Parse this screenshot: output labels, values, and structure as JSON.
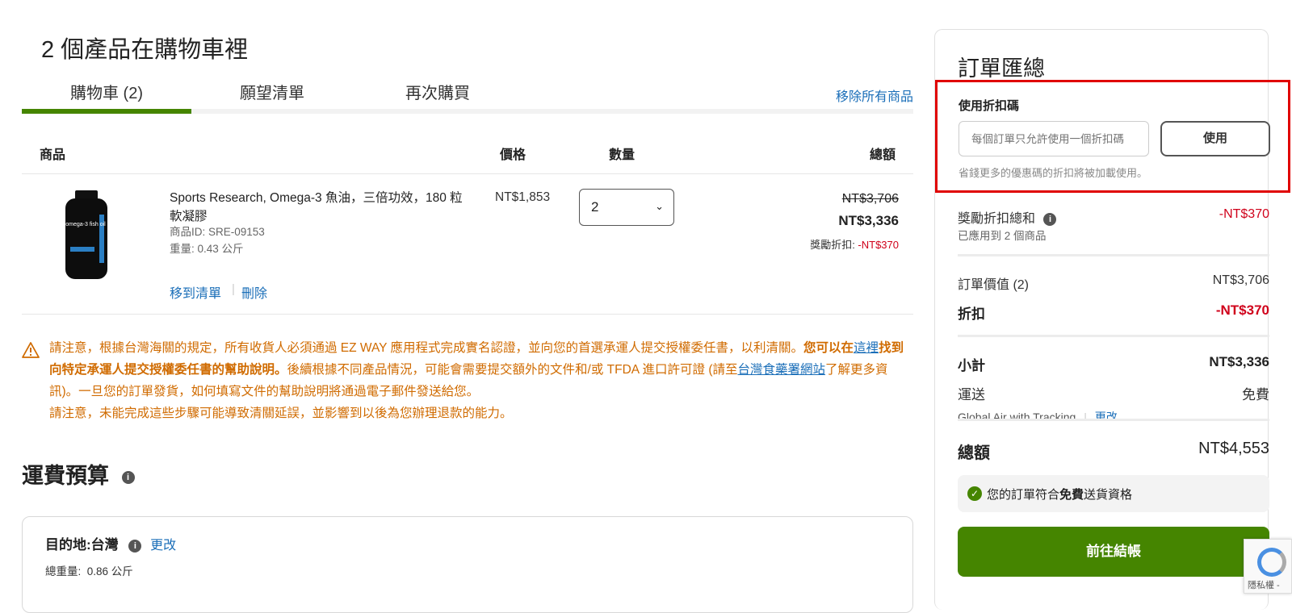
{
  "page_title": "2 個產品在購物車裡",
  "tabs": [
    {
      "label": "購物車 (2)",
      "active": true
    },
    {
      "label": "願望清單",
      "active": false
    },
    {
      "label": "再次購買",
      "active": false
    }
  ],
  "remove_all": "移除所有商品",
  "table_headers": {
    "product": "商品",
    "price": "價格",
    "qty": "數量",
    "total": "總額"
  },
  "item": {
    "name": "Sports Research, Omega-3 魚油，三倍功效，180 粒軟凝膠",
    "product_id": "商品ID: SRE-09153",
    "weight": "重量: 0.43 公斤",
    "move_to_list": "移到清單",
    "delete": "刪除",
    "unit_price": "NT$1,853",
    "quantity": "2",
    "original_total": "NT$3,706",
    "discounted_total": "NT$3,336",
    "reward_label": "獎勵折扣: ",
    "reward_value": "-NT$370",
    "image_label": "omega-3 fish oil"
  },
  "notice": {
    "part1": "請注意，根據台灣海關的規定，所有收貨人必須通過 EZ WAY 應用程式完成實名認證，並向您的首選承運人提交授權委任書，以利清關。",
    "bold1": "您可以在",
    "link1": "這裡",
    "bold2": "找到向特定承運人提交授權委任書的幫助說明。",
    "part2": "後續根據不同產品情況，可能會需要提交額外的文件和/或 TFDA 進口許可證 (請至",
    "link2": "台灣食藥署網站",
    "part3": "了解更多資訊)。一旦您的訂單發貨，如何填寫文件的幫助說明將通過電子郵件發送給您。",
    "line2": "請注意，未能完成這些步驟可能導致清關延誤，並影響到以後為您辦理退款的能力。"
  },
  "shipping_estimate": {
    "title": "運費預算",
    "destination_label": "目的地:",
    "destination": "台灣",
    "change": "更改",
    "total_weight_label": "總重量:",
    "total_weight": "0.86 公斤"
  },
  "summary": {
    "title": "訂單匯總",
    "promo_label": "使用折扣碼",
    "promo_placeholder": "每個訂單只允許使用一個折扣碼",
    "promo_button": "使用",
    "promo_hint": "省錢更多的優惠碼的折扣將被加載使用。",
    "reward_total_label": "獎勵折扣總和",
    "reward_total_value": "-NT$370",
    "reward_applied": "已應用到 2 個商品",
    "order_value_label": "訂單價值 (2)",
    "order_value": "NT$3,706",
    "discount_label": "折扣",
    "discount_value": "-NT$370",
    "subtotal_label": "小計",
    "subtotal_value": "NT$3,336",
    "shipping_label": "運送",
    "shipping_value": "免費",
    "shipping_method": "Global Air with Tracking",
    "shipping_change": "更改",
    "total_label": "總額",
    "total_value": "NT$4,553",
    "free_ship_pre": "您的訂單符合",
    "free_ship_bold": "免費",
    "free_ship_post": "送貨資格",
    "checkout_button": "前往結帳"
  },
  "recaptcha_text": "隱私權 -",
  "colors": {
    "accent_green": "#458500",
    "link_blue": "#1a6eb8",
    "warning_orange": "#d06b00",
    "discount_red": "#d0021b",
    "highlight_red": "#e00000"
  }
}
